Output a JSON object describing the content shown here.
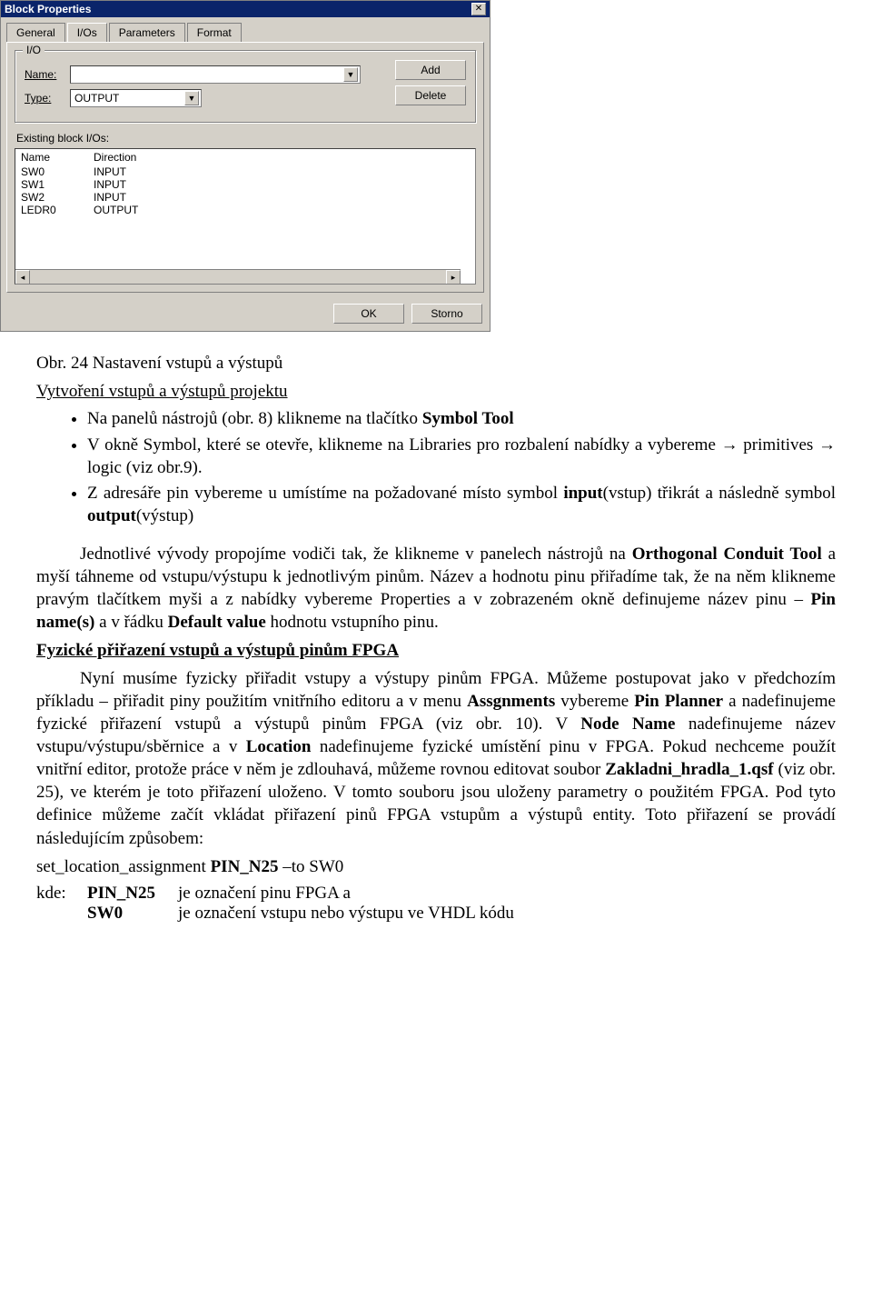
{
  "dialog": {
    "title": "Block Properties",
    "tabs": [
      {
        "label": "General"
      },
      {
        "label": "I/Os"
      },
      {
        "label": "Parameters"
      },
      {
        "label": "Format"
      }
    ],
    "active_tab": "I/Os",
    "io_group": {
      "legend": "I/O",
      "name_label": "Name:",
      "name_value": "",
      "type_label": "Type:",
      "type_value": "OUTPUT",
      "add_label": "Add",
      "delete_label": "Delete"
    },
    "existing_label": "Existing block I/Os:",
    "table": {
      "headers": [
        "Name",
        "Direction"
      ],
      "rows": [
        [
          "SW0",
          "INPUT"
        ],
        [
          "SW1",
          "INPUT"
        ],
        [
          "SW2",
          "INPUT"
        ],
        [
          "LEDR0",
          "OUTPUT"
        ]
      ]
    },
    "ok_label": "OK",
    "cancel_label": "Storno"
  },
  "doc": {
    "caption": "Obr. 24 Nastavení vstupů a výstupů",
    "sec1_title": "Vytvoření vstupů a výstupů projektu",
    "bullets": [
      "Na panelů nástrojů (obr. 8) klikneme na tlačítko <b>Symbol Tool</b>",
      "V okně Symbol, které se otevře, klikneme na Libraries pro rozbalení nabídky a vybereme → primitives → logic (viz obr.9).",
      "Z adresáře pin vybereme u umístíme na požadované místo symbol <b>input</b>(vstup) třikrát a následně symbol <b>output</b>(výstup)"
    ],
    "p1": "Jednotlivé vývody propojíme vodiči tak, že klikneme v panelech nástrojů na <b>Orthogonal Conduit Tool</b> a myší táhneme od vstupu/výstupu k jednotlivým pinům. Název a hodnotu pinu přiřadíme tak, že na něm klikneme pravým tlačítkem myši a z nabídky vybereme Properties a v zobrazeném okně definujeme název pinu – <b>Pin name(s)</b> a v řádku <b>Default value</b> hodnotu vstupního pinu.",
    "sec2_title": "Fyzické přiřazení vstupů a výstupů pinům FPGA",
    "p2": "Nyní musíme fyzicky přiřadit vstupy a výstupy pinům FPGA. Můžeme postupovat jako v předchozím příkladu – přiřadit piny použitím vnitřního editoru a v menu <b>Assgnments</b> vybereme <b>Pin Planner</b> a nadefinujeme fyzické přiřazení vstupů a výstupů pinům FPGA (viz obr. 10). V <b>Node Name</b> nadefinujeme název vstupu/výstupu/sběrnice a v <b>Location</b> nadefinujeme fyzické umístění pinu v FPGA. Pokud nechceme použít vnitřní editor, protože práce v něm je zdlouhavá, můžeme rovnou editovat soubor <b>Zakladni_hradla_1.qsf</b> (viz obr. 25), ve kterém je toto přiřazení uloženo. V tomto souboru jsou uloženy parametry o použitém FPGA. Pod tyto definice můžeme začít vkládat přiřazení pinů FPGA vstupům a výstupů entity. Toto přiřazení se provádí následujícím způsobem:",
    "code": "set_location_assignment <b>PIN_N25</b> –to SW0",
    "def": {
      "kde": "kde:",
      "r1_key": "PIN_N25",
      "r1_val": "je označení pinu FPGA a",
      "r2_key": "SW0",
      "r2_val": "je označení vstupu nebo výstupu ve VHDL kódu"
    }
  }
}
